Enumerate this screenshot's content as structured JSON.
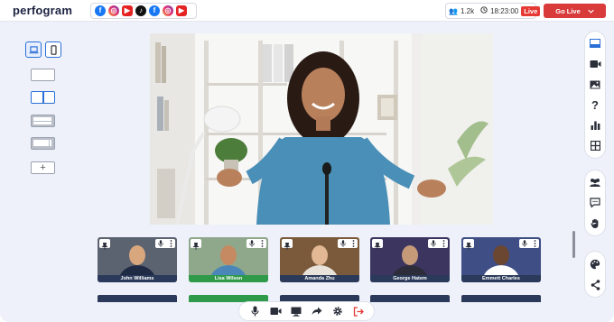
{
  "header": {
    "logo": "perfogram",
    "viewers": "1.2k",
    "timer": "18:23:00",
    "live_badge": "Live",
    "go_live_label": "Go Live",
    "socials": [
      {
        "name": "facebook",
        "glyph": "f"
      },
      {
        "name": "instagram",
        "glyph": "◎"
      },
      {
        "name": "youtube",
        "glyph": "▶"
      },
      {
        "name": "tiktok",
        "glyph": "♪"
      },
      {
        "name": "facebook",
        "glyph": "f"
      },
      {
        "name": "instagram",
        "glyph": "◎"
      },
      {
        "name": "youtube",
        "glyph": "▶"
      }
    ]
  },
  "layout_panel": {
    "add_glyph": "+"
  },
  "participants": [
    {
      "name": "John Williams",
      "active": false,
      "bg": "#5b6270",
      "shirt": "#1f2a44",
      "skin": "#d9a77e"
    },
    {
      "name": "Lisa Wilson",
      "active": true,
      "bg": "#8fa88c",
      "shirt": "#4a86b8",
      "skin": "#c58a62"
    },
    {
      "name": "Amanda Zhu",
      "active": false,
      "bg": "#7a5a3a",
      "shirt": "#e9e2da",
      "skin": "#e2b895"
    },
    {
      "name": "George Hatem",
      "active": false,
      "bg": "#3c3560",
      "shirt": "#2c2c3a",
      "skin": "#c49a78"
    },
    {
      "name": "Emmett Charles",
      "active": false,
      "bg": "#3f4f86",
      "shirt": "#ffffff",
      "skin": "#6b4630"
    }
  ],
  "second_row_colors": [
    "#2b3a5a",
    "#2e9a4a",
    "#2b3a5a",
    "#2b3a5a",
    "#2b3a5a"
  ],
  "colors": {
    "accent": "#2a6fd6",
    "go_live": "#d93a3a",
    "live_badge": "#e53935",
    "active_name": "#2e9a4a",
    "name_bar": "#2b3a5a"
  }
}
